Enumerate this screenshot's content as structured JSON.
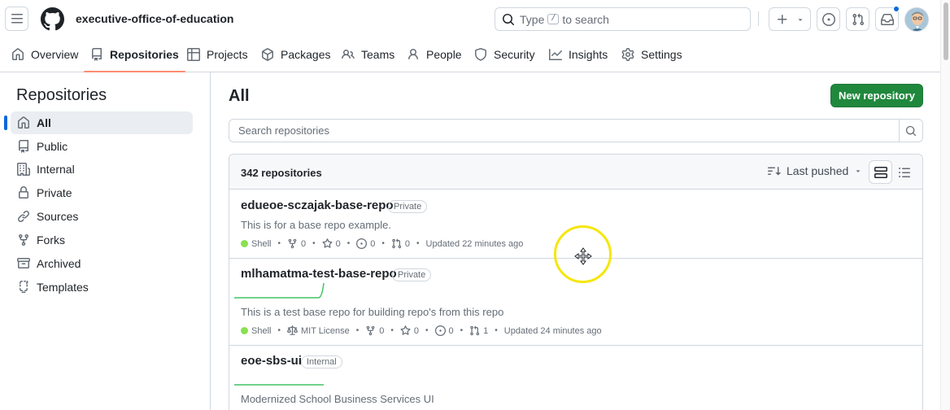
{
  "header": {
    "org_name": "executive-office-of-education",
    "search": {
      "prefix": "Type",
      "key": "/",
      "suffix": "to search"
    }
  },
  "nav": {
    "tabs": [
      {
        "label": "Overview",
        "icon": "home-icon"
      },
      {
        "label": "Repositories",
        "icon": "repo-icon",
        "selected": true
      },
      {
        "label": "Projects",
        "icon": "table-icon"
      },
      {
        "label": "Packages",
        "icon": "package-icon"
      },
      {
        "label": "Teams",
        "icon": "people-icon"
      },
      {
        "label": "People",
        "icon": "person-icon"
      },
      {
        "label": "Security",
        "icon": "shield-icon"
      },
      {
        "label": "Insights",
        "icon": "graph-icon"
      },
      {
        "label": "Settings",
        "icon": "gear-icon"
      }
    ]
  },
  "sidebar": {
    "title": "Repositories",
    "items": [
      {
        "label": "All",
        "icon": "home-icon",
        "selected": true
      },
      {
        "label": "Public",
        "icon": "repo-icon"
      },
      {
        "label": "Internal",
        "icon": "organization-icon"
      },
      {
        "label": "Private",
        "icon": "lock-repo-icon"
      },
      {
        "label": "Sources",
        "icon": "link-icon"
      },
      {
        "label": "Forks",
        "icon": "fork-icon"
      },
      {
        "label": "Archived",
        "icon": "archive-icon"
      },
      {
        "label": "Templates",
        "icon": "template-icon"
      }
    ]
  },
  "main": {
    "title": "All",
    "new_repo_label": "New repository",
    "search_placeholder": "Search repositories",
    "repo_count": "342 repositories",
    "sort_label": "Last pushed",
    "accent_color": "#1f883d",
    "repos": [
      {
        "name": "edueoe-sczajak-base-repo",
        "visibility": "Private",
        "description": "This is for a base repo example.",
        "language": "Shell",
        "forks": "0",
        "stars": "0",
        "issues": "0",
        "pulls": "0",
        "updated": "Updated 22 minutes ago"
      },
      {
        "name": "mlhamatma-test-base-repo",
        "visibility": "Private",
        "description": "This is a test base repo for building repo's from this repo",
        "language": "Shell",
        "license": "MIT License",
        "forks": "0",
        "stars": "0",
        "issues": "0",
        "pulls": "1",
        "updated": "Updated 24 minutes ago"
      },
      {
        "name": "eoe-sbs-ui",
        "visibility": "Internal",
        "description": "Modernized School Business Services UI"
      }
    ]
  }
}
